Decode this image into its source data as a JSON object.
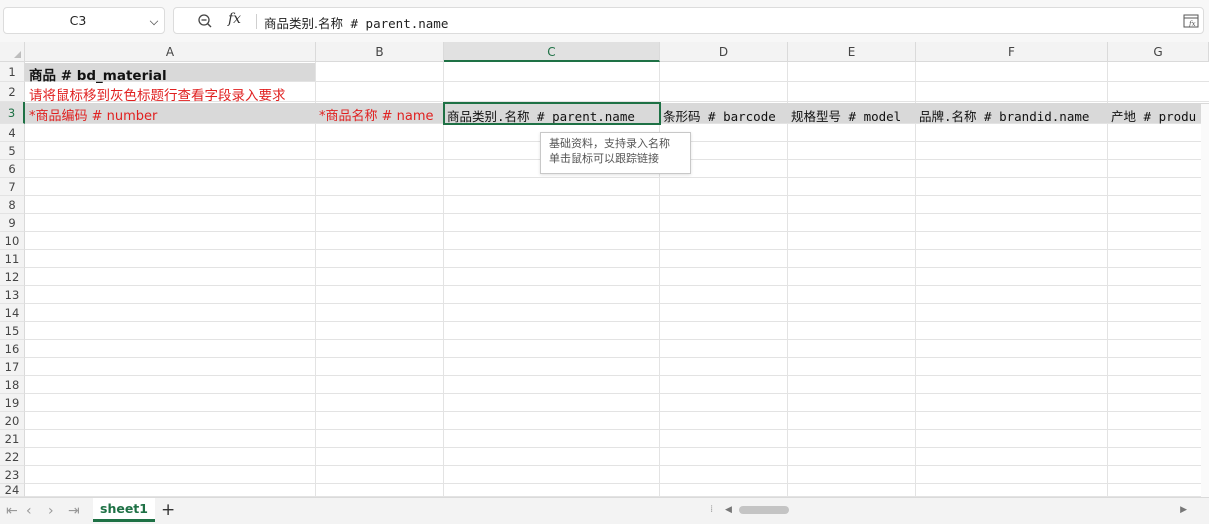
{
  "formula_bar": {
    "name_box": "C3",
    "fx_label": "fx",
    "formula_cjk": "商品类别.名称",
    "formula_rest": " # parent.name"
  },
  "columns": [
    "A",
    "B",
    "C",
    "D",
    "E",
    "F",
    "G"
  ],
  "selected_column": "C",
  "rows": [
    "1",
    "2",
    "3",
    "4",
    "5",
    "6",
    "7",
    "8",
    "9",
    "10",
    "11",
    "12",
    "13",
    "14",
    "15",
    "16",
    "17",
    "18",
    "19",
    "20",
    "21",
    "22",
    "23",
    "24"
  ],
  "selected_row": "3",
  "cells": {
    "A1": "商品 # bd_material",
    "A2": "请将鼠标移到灰色标题行查看字段录入要求",
    "A3": "*商品编码 # number",
    "B3": "*商品名称 # name",
    "C3": "商品类别.名称 # parent.name",
    "D3": "条形码 # barcode",
    "E3": "规格型号 # model",
    "F3": "品牌.名称 # brandid.name",
    "G3": "产地 # produ"
  },
  "tooltip": {
    "line1": "基础资料，支持录入名称",
    "line2": "单击鼠标可以跟踪链接"
  },
  "sheet_tabs": [
    "sheet1"
  ],
  "add_sheet_label": "+",
  "colors": {
    "accent_green": "#1e7145",
    "required_red": "#e02020",
    "header_gray": "#d9d9d9"
  }
}
